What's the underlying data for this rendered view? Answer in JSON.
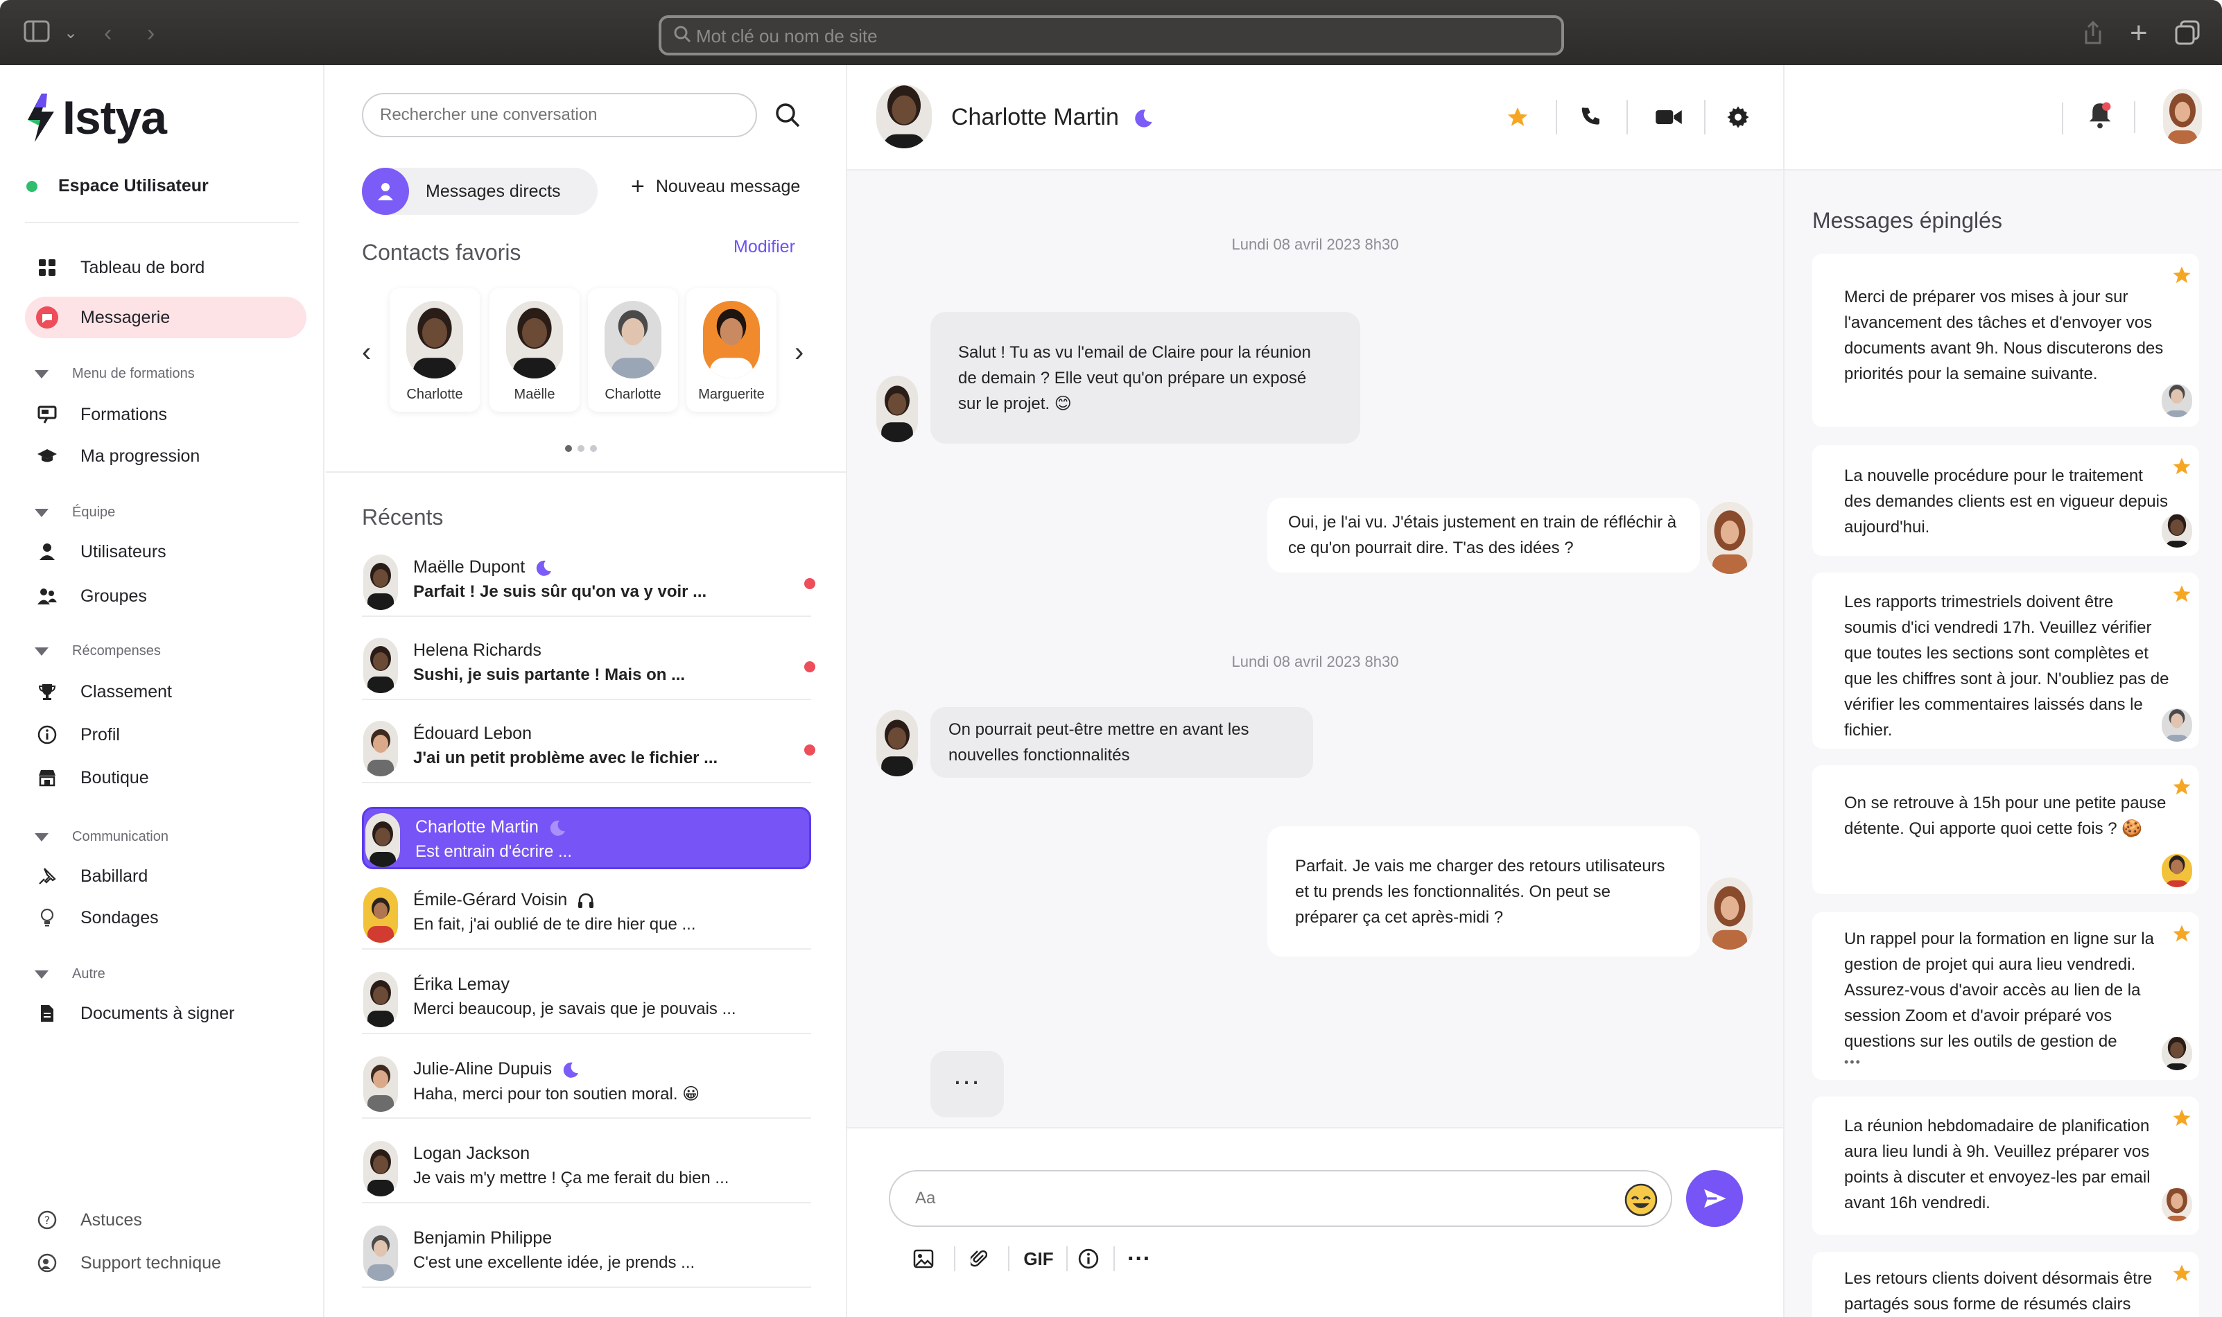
{
  "browser": {
    "address_placeholder": "Mot clé ou nom de site"
  },
  "brand": {
    "name": "Istya"
  },
  "workspace": {
    "label": "Espace Utilisateur"
  },
  "nav": {
    "dashboard": "Tableau de bord",
    "messaging": "Messagerie",
    "sec_trainings": "Menu de formations",
    "trainings": "Formations",
    "progress": "Ma progression",
    "sec_team": "Équipe",
    "users": "Utilisateurs",
    "groups": "Groupes",
    "sec_rewards": "Récompenses",
    "ranking": "Classement",
    "profile": "Profil",
    "shop": "Boutique",
    "sec_communication": "Communication",
    "board": "Babillard",
    "polls": "Sondages",
    "sec_other": "Autre",
    "documents": "Documents à signer",
    "tips": "Astuces",
    "support": "Support technique"
  },
  "conversations_panel": {
    "search_placeholder": "Rechercher une conversation",
    "direct_messages": "Messages directs",
    "new_message": "Nouveau message",
    "favorites_title": "Contacts favoris",
    "favorites_edit": "Modifier",
    "favorites": [
      {
        "name": "Charlotte"
      },
      {
        "name": "Maëlle"
      },
      {
        "name": "Charlotte"
      },
      {
        "name": "Marguerite"
      }
    ],
    "recent_title": "Récents",
    "recent": [
      {
        "name": "Maëlle Dupont",
        "preview": "Parfait ! Je suis sûr qu'on va y voir ..."
      },
      {
        "name": "Helena Richards",
        "preview": "Sushi, je suis partante ! Mais on ..."
      },
      {
        "name": "Édouard Lebon",
        "preview": "J'ai un petit problème avec le fichier ..."
      },
      {
        "name": "Charlotte Martin",
        "preview": "Est entrain d'écrire ..."
      },
      {
        "name": "Émile-Gérard Voisin",
        "preview": "En fait, j'ai oublié de te dire hier que ..."
      },
      {
        "name": "Érika Lemay",
        "preview": "Merci beaucoup, je savais que je pouvais ..."
      },
      {
        "name": "Julie-Aline Dupuis",
        "preview": "Haha, merci pour ton soutien moral. 😀"
      },
      {
        "name": "Logan Jackson",
        "preview": "Je vais m'y mettre ! Ça me ferait du bien ..."
      },
      {
        "name": "Benjamin Philippe",
        "preview": "C'est une excellente idée, je prends ..."
      }
    ]
  },
  "chat": {
    "contact_name": "Charlotte Martin",
    "timestamp_1": "Lundi 08 avril 2023 8h30",
    "timestamp_2": "Lundi 08 avril 2023 8h30",
    "messages": [
      {
        "text": "Salut ! Tu as vu l'email de Claire pour la réunion de demain ? Elle veut qu'on prépare un exposé sur le projet. 😊"
      },
      {
        "text": "Oui, je l'ai vu. J'étais justement en train de réfléchir à ce qu'on pourrait dire. T'as des idées ?"
      },
      {
        "text": "On pourrait peut-être mettre en avant les nouvelles fonctionnalités"
      },
      {
        "text": "Parfait. Je vais me charger des retours utilisateurs et tu prends les fonctionnalités. On peut se préparer ça cet après-midi ?"
      }
    ],
    "typing": "...",
    "composer_placeholder": "Aa",
    "tool_gif": "GIF",
    "tool_more": "···"
  },
  "pinned": {
    "title": "Messages épinglés",
    "items": [
      {
        "text": "Merci de préparer vos mises à jour sur l'avancement des tâches et d'envoyer vos documents avant 9h. Nous discuterons des priorités pour la semaine suivante."
      },
      {
        "text": "La nouvelle procédure pour le traitement des demandes clients est en vigueur depuis aujourd'hui."
      },
      {
        "text": "Les rapports trimestriels doivent être soumis d'ici vendredi 17h. Veuillez vérifier que toutes les sections sont complètes et que les chiffres sont à jour. N'oubliez pas de vérifier les commentaires laissés dans le fichier."
      },
      {
        "text": "On se retrouve à 15h pour une petite pause détente.  Qui apporte quoi cette fois ? 🍪"
      },
      {
        "text": "Un rappel pour la formation en ligne sur la gestion de projet qui aura lieu vendredi. Assurez-vous d'avoir accès au lien de la session Zoom et d'avoir préparé vos questions sur les outils de gestion de",
        "more": "•••"
      },
      {
        "text": "La réunion hebdomadaire de planification aura lieu lundi à 9h. Veuillez préparer vos points à discuter et envoyez-les par email avant 16h vendredi."
      },
      {
        "text": "Les retours clients doivent désormais être partagés sous forme de résumés clairs"
      }
    ]
  },
  "colors": {
    "accent": "#7654f5",
    "active_nav": "#fde3e6",
    "unread": "#ee4d5a",
    "star": "#f5a623",
    "online": "#2fbe6e"
  }
}
